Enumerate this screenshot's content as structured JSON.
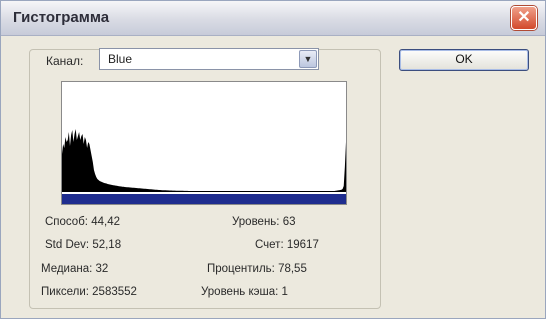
{
  "window": {
    "title": "Гистограмма",
    "close_icon": "close-x-icon",
    "close_glyph": "✕"
  },
  "channel": {
    "label": "Канал:",
    "value": "Blue",
    "dropdown_glyph": "▼"
  },
  "ok_button": {
    "label": "OK"
  },
  "histogram": {
    "levels": 256,
    "values": [
      0.38,
      0.48,
      0.44,
      0.55,
      0.5,
      0.52,
      0.6,
      0.46,
      0.57,
      0.62,
      0.5,
      0.58,
      0.63,
      0.52,
      0.56,
      0.6,
      0.52,
      0.56,
      0.58,
      0.48,
      0.55,
      0.52,
      0.44,
      0.5,
      0.48,
      0.42,
      0.36,
      0.3,
      0.22,
      0.18,
      0.15,
      0.13,
      0.12,
      0.11,
      0.105,
      0.1,
      0.095,
      0.09,
      0.088,
      0.085,
      0.08,
      0.078,
      0.075,
      0.072,
      0.07,
      0.068,
      0.066,
      0.064,
      0.062,
      0.06,
      0.058,
      0.056,
      0.055,
      0.053,
      0.052,
      0.05,
      0.049,
      0.048,
      0.047,
      0.046,
      0.045,
      0.044,
      0.043,
      0.042,
      0.041,
      0.04,
      0.039,
      0.038,
      0.037,
      0.036,
      0.035,
      0.034,
      0.033,
      0.032,
      0.031,
      0.03,
      0.029,
      0.028,
      0.027,
      0.026,
      0.025,
      0.024,
      0.023,
      0.022,
      0.021,
      0.02,
      0.02,
      0.019,
      0.018,
      0.018,
      0.017,
      0.017,
      0.016,
      0.016,
      0.015,
      0.015,
      0.015,
      0.014,
      0.014,
      0.014,
      0.013,
      0.013,
      0.013,
      0.012,
      0.012,
      0.012,
      0.012,
      0.011,
      0.011,
      0.011,
      0.011,
      0.01,
      0.01,
      0.01,
      0.01,
      0.01,
      0.01,
      0.01,
      0.01,
      0.01,
      0.01,
      0.01,
      0.01,
      0.01,
      0.01,
      0.01,
      0.01,
      0.01,
      0.01,
      0.01,
      0.01,
      0.01,
      0.01,
      0.01,
      0.01,
      0.01,
      0.01,
      0.01,
      0.01,
      0.01,
      0.01,
      0.01,
      0.01,
      0.01,
      0.01,
      0.01,
      0.01,
      0.01,
      0.01,
      0.01,
      0.01,
      0.01,
      0.01,
      0.01,
      0.01,
      0.01,
      0.01,
      0.01,
      0.01,
      0.01,
      0.01,
      0.01,
      0.01,
      0.01,
      0.01,
      0.01,
      0.01,
      0.01,
      0.01,
      0.01,
      0.01,
      0.01,
      0.01,
      0.01,
      0.01,
      0.01,
      0.01,
      0.01,
      0.01,
      0.01,
      0.01,
      0.01,
      0.01,
      0.01,
      0.01,
      0.01,
      0.01,
      0.01,
      0.01,
      0.01,
      0.01,
      0.01,
      0.01,
      0.01,
      0.01,
      0.01,
      0.01,
      0.01,
      0.01,
      0.01,
      0.01,
      0.01,
      0.01,
      0.01,
      0.01,
      0.01,
      0.01,
      0.01,
      0.01,
      0.01,
      0.01,
      0.01,
      0.01,
      0.01,
      0.01,
      0.01,
      0.01,
      0.01,
      0.01,
      0.01,
      0.01,
      0.01,
      0.01,
      0.01,
      0.01,
      0.01,
      0.01,
      0.01,
      0.01,
      0.01,
      0.01,
      0.01,
      0.01,
      0.01,
      0.01,
      0.01,
      0.01,
      0.01,
      0.01,
      0.01,
      0.012,
      0.014,
      0.016,
      0.018,
      0.02,
      0.022,
      0.03,
      0.06,
      0.25,
      0.5
    ],
    "fill_color": "#000000",
    "gradient_bar_color": "#1f2d8f"
  },
  "stats": {
    "mean_label": "Способ:",
    "mean_value": "44,42",
    "stddev_label": "Std Dev:",
    "stddev_value": "52,18",
    "median_label": "Медиана:",
    "median_value": "32",
    "pixels_label": "Пиксели:",
    "pixels_value": "2583552",
    "level_label": "Уровень:",
    "level_value": "63",
    "count_label": "Счет:",
    "count_value": "19617",
    "percentile_label": "Процентиль:",
    "percentile_value": "78,55",
    "cache_label": "Уровень кэша:",
    "cache_value": "1"
  }
}
